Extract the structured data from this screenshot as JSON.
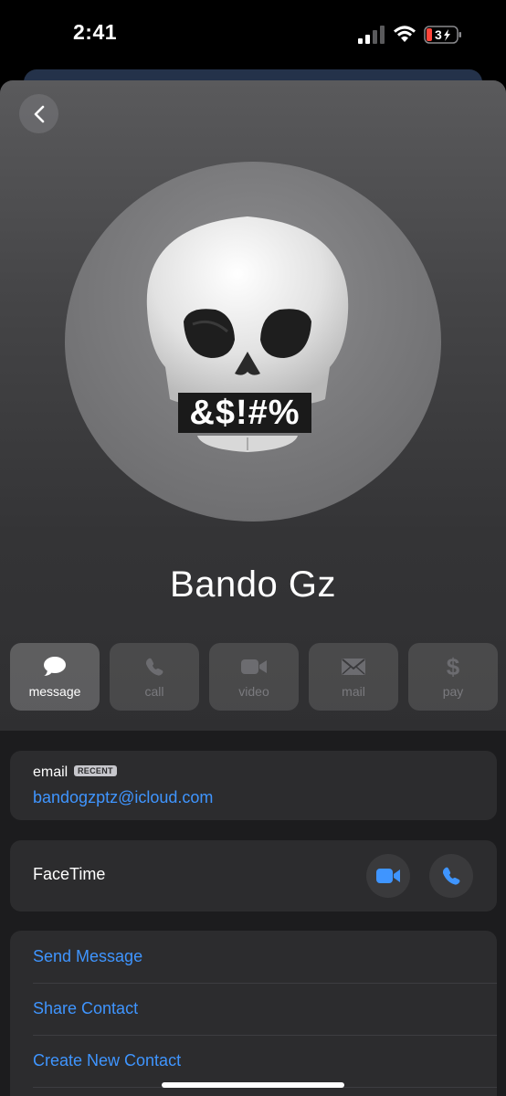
{
  "status_bar": {
    "time": "2:41",
    "battery": "3"
  },
  "contact": {
    "name": "Bando Gz",
    "memoji_caption": "&$!#%"
  },
  "actions": [
    {
      "label": "message",
      "icon": "message-bubble-icon"
    },
    {
      "label": "call",
      "icon": "phone-icon"
    },
    {
      "label": "video",
      "icon": "video-camera-icon"
    },
    {
      "label": "mail",
      "icon": "envelope-icon"
    },
    {
      "label": "pay",
      "icon": "dollar-icon"
    }
  ],
  "email": {
    "label": "email",
    "badge": "RECENT",
    "value": "bandogzptz@icloud.com"
  },
  "facetime": {
    "label": "FaceTime"
  },
  "links": [
    "Send Message",
    "Share Contact",
    "Create New Contact"
  ],
  "colors": {
    "accent": "#3f95ff",
    "sheet": "#1c1c1e",
    "card": "#2c2c2e"
  }
}
